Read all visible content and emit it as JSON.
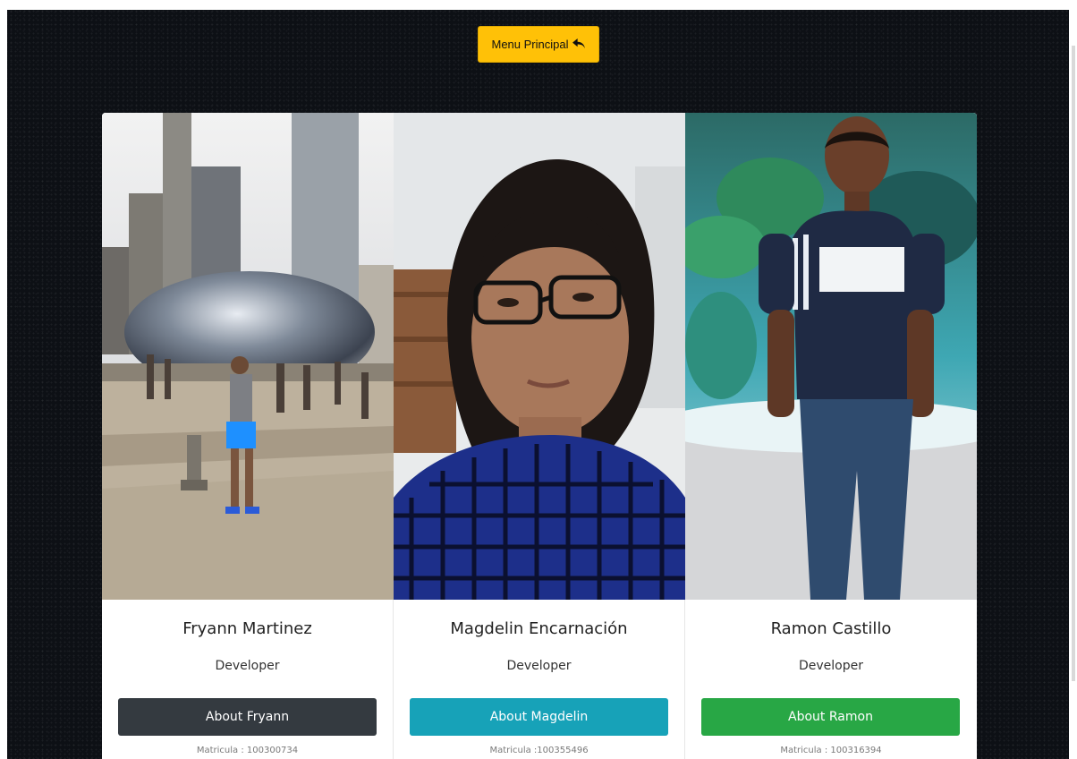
{
  "header": {
    "menu_label": "Menu Principal",
    "menu_icon": "reply-arrow-icon",
    "accent": "#ffc107"
  },
  "cards": [
    {
      "name": "Fryann Martinez",
      "role": "Developer",
      "button_label": "About Fryann",
      "button_color": "#343a40",
      "matricula": "Matricula : 100300734"
    },
    {
      "name": "Magdelin Encarnación",
      "role": "Developer",
      "button_label": "About Magdelin",
      "button_color": "#17a2b8",
      "matricula": "Matricula :100355496"
    },
    {
      "name": "Ramon Castillo",
      "role": "Developer",
      "button_label": "About Ramon",
      "button_color": "#28a745",
      "matricula": "Matricula : 100316394"
    }
  ]
}
